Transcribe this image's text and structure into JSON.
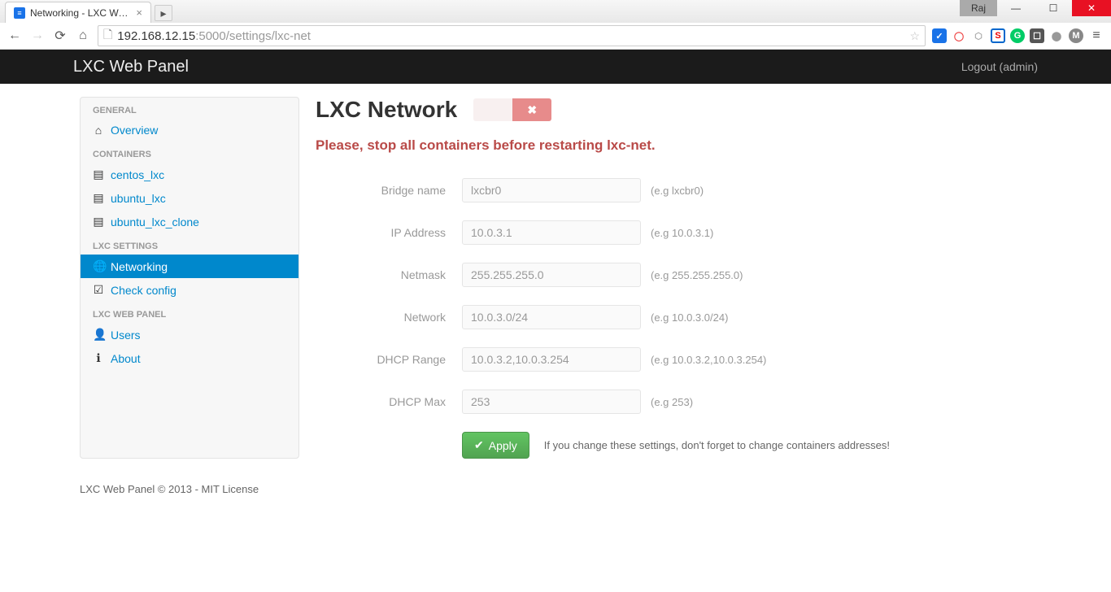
{
  "browser": {
    "tab_title": "Networking - LXC Web Pa",
    "url_host": "192.168.12.15",
    "url_port": ":5000",
    "url_path": "/settings/lxc-net",
    "user_badge": "Raj"
  },
  "navbar": {
    "brand": "LXC Web Panel",
    "logout": "Logout (admin)"
  },
  "sidebar": {
    "headers": {
      "general": "General",
      "containers": "Containers",
      "settings": "LXC Settings",
      "panel": "LXC Web Panel"
    },
    "items": {
      "overview": "Overview",
      "centos": "centos_lxc",
      "ubuntu": "ubuntu_lxc",
      "ubuntu_clone": "ubuntu_lxc_clone",
      "networking": "Networking",
      "check_config": "Check config",
      "users": "Users",
      "about": "About"
    }
  },
  "page": {
    "title": "LXC Network",
    "warning": "Please, stop all containers before restarting lxc-net.",
    "apply_label": "Apply",
    "apply_note": "If you change these settings, don't forget to change containers addresses!"
  },
  "form": {
    "bridge": {
      "label": "Bridge name",
      "value": "lxcbr0",
      "hint": "(e.g lxcbr0)"
    },
    "ip": {
      "label": "IP Address",
      "value": "10.0.3.1",
      "hint": "(e.g 10.0.3.1)"
    },
    "netmask": {
      "label": "Netmask",
      "value": "255.255.255.0",
      "hint": "(e.g 255.255.255.0)"
    },
    "network": {
      "label": "Network",
      "value": "10.0.3.0/24",
      "hint": "(e.g 10.0.3.0/24)"
    },
    "dhcp_range": {
      "label": "DHCP Range",
      "value": "10.0.3.2,10.0.3.254",
      "hint": "(e.g 10.0.3.2,10.0.3.254)"
    },
    "dhcp_max": {
      "label": "DHCP Max",
      "value": "253",
      "hint": "(e.g 253)"
    }
  },
  "footer": {
    "text": "LXC Web Panel © 2013 - MIT License"
  }
}
